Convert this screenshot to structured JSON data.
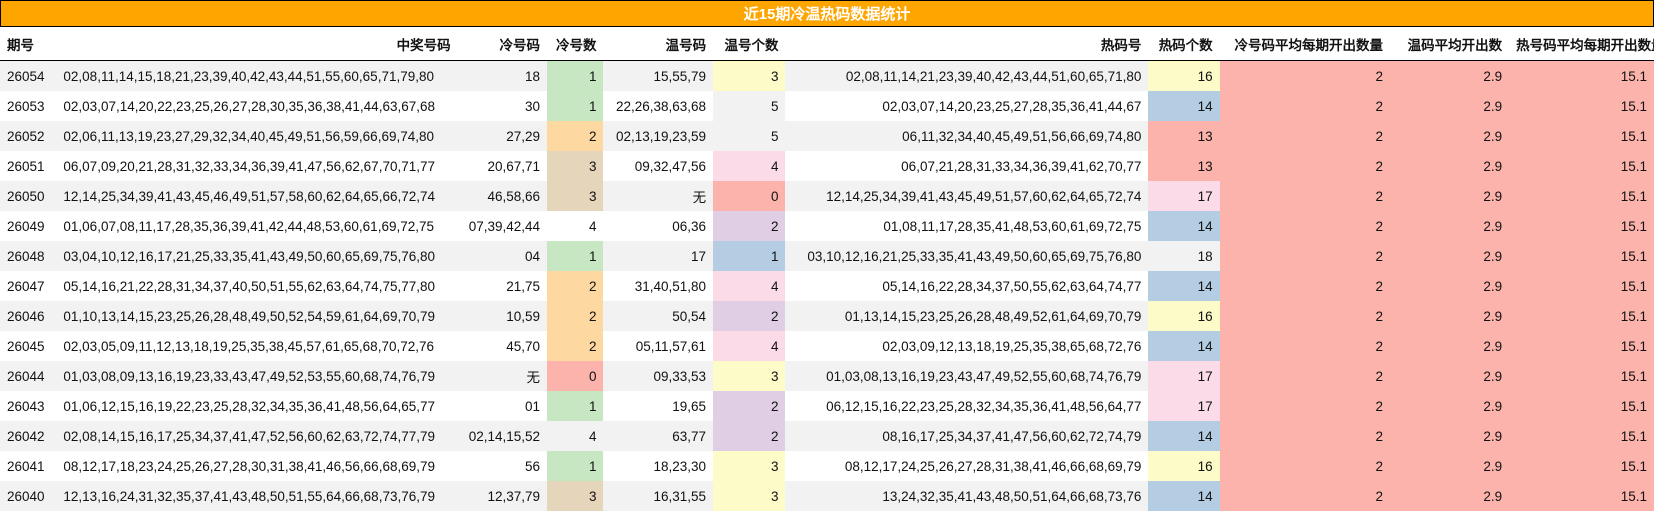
{
  "title": "近15期冷温热码数据统计",
  "headers": [
    "期号",
    "中奖号码",
    "冷号码",
    "冷号数",
    "温号码",
    "温号个数",
    "热码号",
    "热码个数",
    "冷号码平均每期开出数量",
    "温码平均开出数",
    "热号码平均每期开出数量"
  ],
  "colors": {
    "header_bg": "#ffa500",
    "avg_bg": "#fcb3ac",
    "green": "#c6e7c2",
    "orange": "#fed8a1",
    "tan": "#e5d5bb",
    "yellow": "#fdfbc8",
    "pink": "#fcdbe9",
    "lavender": "#dfcee4",
    "blue": "#b4cde3",
    "red": "#fcb3ac",
    "gray": "#f2f2f2"
  },
  "rows": [
    {
      "issue": "26054",
      "numbers": "02,08,11,14,15,18,21,23,39,40,42,43,44,51,55,60,65,71,79,80",
      "cold": "18",
      "cold_count": "1",
      "cold_color": "green",
      "warm": "15,55,79",
      "warm_count": "3",
      "warm_color": "yellow",
      "hot": "02,08,11,14,21,23,39,40,42,43,44,51,60,65,71,80",
      "hot_count": "16",
      "hot_color": "yellow",
      "avg_cold": "2",
      "avg_warm": "2.9",
      "avg_hot": "15.1"
    },
    {
      "issue": "26053",
      "numbers": "02,03,07,14,20,22,23,25,26,27,28,30,35,36,38,41,44,63,67,68",
      "cold": "30",
      "cold_count": "1",
      "cold_color": "green",
      "warm": "22,26,38,63,68",
      "warm_count": "5",
      "warm_color": "gray",
      "hot": "02,03,07,14,20,23,25,27,28,35,36,41,44,67",
      "hot_count": "14",
      "hot_color": "blue",
      "avg_cold": "2",
      "avg_warm": "2.9",
      "avg_hot": "15.1"
    },
    {
      "issue": "26052",
      "numbers": "02,06,11,13,19,23,27,29,32,34,40,45,49,51,56,59,66,69,74,80",
      "cold": "27,29",
      "cold_count": "2",
      "cold_color": "orange",
      "warm": "02,13,19,23,59",
      "warm_count": "5",
      "warm_color": "gray",
      "hot": "06,11,32,34,40,45,49,51,56,66,69,74,80",
      "hot_count": "13",
      "hot_color": "red",
      "avg_cold": "2",
      "avg_warm": "2.9",
      "avg_hot": "15.1"
    },
    {
      "issue": "26051",
      "numbers": "06,07,09,20,21,28,31,32,33,34,36,39,41,47,56,62,67,70,71,77",
      "cold": "20,67,71",
      "cold_count": "3",
      "cold_color": "tan",
      "warm": "09,32,47,56",
      "warm_count": "4",
      "warm_color": "pink",
      "hot": "06,07,21,28,31,33,34,36,39,41,62,70,77",
      "hot_count": "13",
      "hot_color": "red",
      "avg_cold": "2",
      "avg_warm": "2.9",
      "avg_hot": "15.1"
    },
    {
      "issue": "26050",
      "numbers": "12,14,25,34,39,41,43,45,46,49,51,57,58,60,62,64,65,66,72,74",
      "cold": "46,58,66",
      "cold_count": "3",
      "cold_color": "tan",
      "warm": "无",
      "warm_count": "0",
      "warm_color": "red",
      "hot": "12,14,25,34,39,41,43,45,49,51,57,60,62,64,65,72,74",
      "hot_count": "17",
      "hot_color": "pink",
      "avg_cold": "2",
      "avg_warm": "2.9",
      "avg_hot": "15.1"
    },
    {
      "issue": "26049",
      "numbers": "01,06,07,08,11,17,28,35,36,39,41,42,44,48,53,60,61,69,72,75",
      "cold": "07,39,42,44",
      "cold_count": "4",
      "cold_color": "none",
      "warm": "06,36",
      "warm_count": "2",
      "warm_color": "lavender",
      "hot": "01,08,11,17,28,35,41,48,53,60,61,69,72,75",
      "hot_count": "14",
      "hot_color": "blue",
      "avg_cold": "2",
      "avg_warm": "2.9",
      "avg_hot": "15.1"
    },
    {
      "issue": "26048",
      "numbers": "03,04,10,12,16,17,21,25,33,35,41,43,49,50,60,65,69,75,76,80",
      "cold": "04",
      "cold_count": "1",
      "cold_color": "green",
      "warm": "17",
      "warm_count": "1",
      "warm_color": "blue",
      "hot": "03,10,12,16,21,25,33,35,41,43,49,50,60,65,69,75,76,80",
      "hot_count": "18",
      "hot_color": "gray",
      "avg_cold": "2",
      "avg_warm": "2.9",
      "avg_hot": "15.1"
    },
    {
      "issue": "26047",
      "numbers": "05,14,16,21,22,28,31,34,37,40,50,51,55,62,63,64,74,75,77,80",
      "cold": "21,75",
      "cold_count": "2",
      "cold_color": "orange",
      "warm": "31,40,51,80",
      "warm_count": "4",
      "warm_color": "pink",
      "hot": "05,14,16,22,28,34,37,50,55,62,63,64,74,77",
      "hot_count": "14",
      "hot_color": "blue",
      "avg_cold": "2",
      "avg_warm": "2.9",
      "avg_hot": "15.1"
    },
    {
      "issue": "26046",
      "numbers": "01,10,13,14,15,23,25,26,28,48,49,50,52,54,59,61,64,69,70,79",
      "cold": "10,59",
      "cold_count": "2",
      "cold_color": "orange",
      "warm": "50,54",
      "warm_count": "2",
      "warm_color": "lavender",
      "hot": "01,13,14,15,23,25,26,28,48,49,52,61,64,69,70,79",
      "hot_count": "16",
      "hot_color": "yellow",
      "avg_cold": "2",
      "avg_warm": "2.9",
      "avg_hot": "15.1"
    },
    {
      "issue": "26045",
      "numbers": "02,03,05,09,11,12,13,18,19,25,35,38,45,57,61,65,68,70,72,76",
      "cold": "45,70",
      "cold_count": "2",
      "cold_color": "orange",
      "warm": "05,11,57,61",
      "warm_count": "4",
      "warm_color": "pink",
      "hot": "02,03,09,12,13,18,19,25,35,38,65,68,72,76",
      "hot_count": "14",
      "hot_color": "blue",
      "avg_cold": "2",
      "avg_warm": "2.9",
      "avg_hot": "15.1"
    },
    {
      "issue": "26044",
      "numbers": "01,03,08,09,13,16,19,23,33,43,47,49,52,53,55,60,68,74,76,79",
      "cold": "无",
      "cold_count": "0",
      "cold_color": "red",
      "warm": "09,33,53",
      "warm_count": "3",
      "warm_color": "yellow",
      "hot": "01,03,08,13,16,19,23,43,47,49,52,55,60,68,74,76,79",
      "hot_count": "17",
      "hot_color": "pink",
      "avg_cold": "2",
      "avg_warm": "2.9",
      "avg_hot": "15.1"
    },
    {
      "issue": "26043",
      "numbers": "01,06,12,15,16,19,22,23,25,28,32,34,35,36,41,48,56,64,65,77",
      "cold": "01",
      "cold_count": "1",
      "cold_color": "green",
      "warm": "19,65",
      "warm_count": "2",
      "warm_color": "lavender",
      "hot": "06,12,15,16,22,23,25,28,32,34,35,36,41,48,56,64,77",
      "hot_count": "17",
      "hot_color": "pink",
      "avg_cold": "2",
      "avg_warm": "2.9",
      "avg_hot": "15.1"
    },
    {
      "issue": "26042",
      "numbers": "02,08,14,15,16,17,25,34,37,41,47,52,56,60,62,63,72,74,77,79",
      "cold": "02,14,15,52",
      "cold_count": "4",
      "cold_color": "none",
      "warm": "63,77",
      "warm_count": "2",
      "warm_color": "lavender",
      "hot": "08,16,17,25,34,37,41,47,56,60,62,72,74,79",
      "hot_count": "14",
      "hot_color": "blue",
      "avg_cold": "2",
      "avg_warm": "2.9",
      "avg_hot": "15.1"
    },
    {
      "issue": "26041",
      "numbers": "08,12,17,18,23,24,25,26,27,28,30,31,38,41,46,56,66,68,69,79",
      "cold": "56",
      "cold_count": "1",
      "cold_color": "green",
      "warm": "18,23,30",
      "warm_count": "3",
      "warm_color": "yellow",
      "hot": "08,12,17,24,25,26,27,28,31,38,41,46,66,68,69,79",
      "hot_count": "16",
      "hot_color": "yellow",
      "avg_cold": "2",
      "avg_warm": "2.9",
      "avg_hot": "15.1"
    },
    {
      "issue": "26040",
      "numbers": "12,13,16,24,31,32,35,37,41,43,48,50,51,55,64,66,68,73,76,79",
      "cold": "12,37,79",
      "cold_count": "3",
      "cold_color": "tan",
      "warm": "16,31,55",
      "warm_count": "3",
      "warm_color": "yellow",
      "hot": "13,24,32,35,41,43,48,50,51,64,66,68,73,76",
      "hot_count": "14",
      "hot_color": "blue",
      "avg_cold": "2",
      "avg_warm": "2.9",
      "avg_hot": "15.1"
    }
  ]
}
